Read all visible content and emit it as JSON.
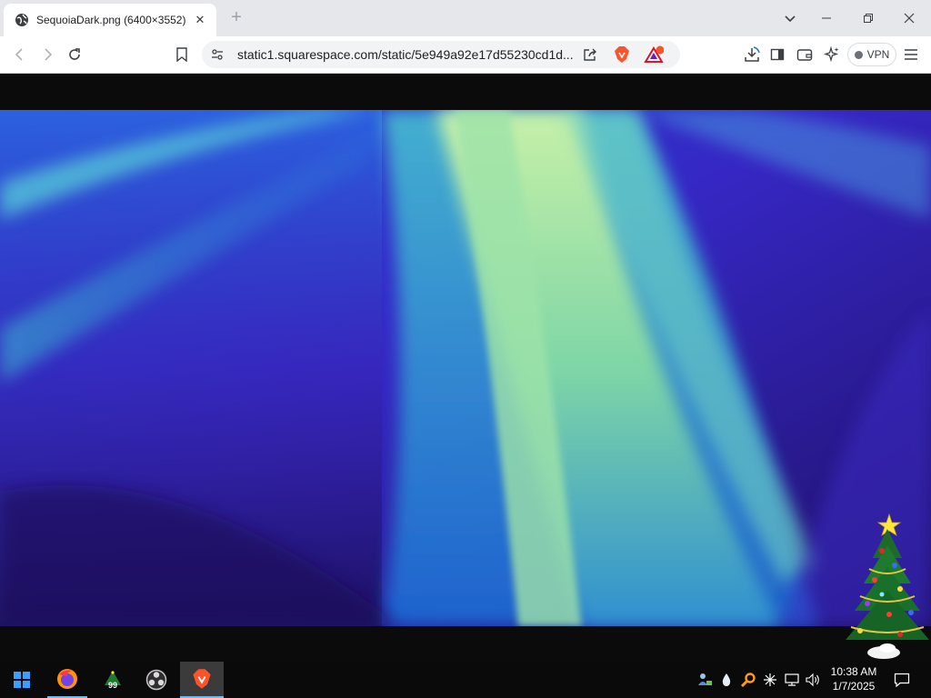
{
  "tab": {
    "title": "SequoiaDark.png (6400×3552)",
    "favicon": "globe-icon"
  },
  "address": {
    "url": "static1.squarespace.com/static/5e949a92e17d55230cd1d..."
  },
  "toolbar": {
    "vpn_label": "VPN"
  },
  "taskbar": {
    "apps": [
      "firefox-icon",
      "christmas-tree-99-icon",
      "obs-icon",
      "brave-icon"
    ],
    "badge_99": "99",
    "time": "10:38 AM",
    "date": "1/7/2025"
  },
  "colors": {
    "tab_strip": "#e5e7ea",
    "toolbar": "#ffffff",
    "brave_orange": "#fb542b",
    "taskbar": "#0a0a0a"
  }
}
